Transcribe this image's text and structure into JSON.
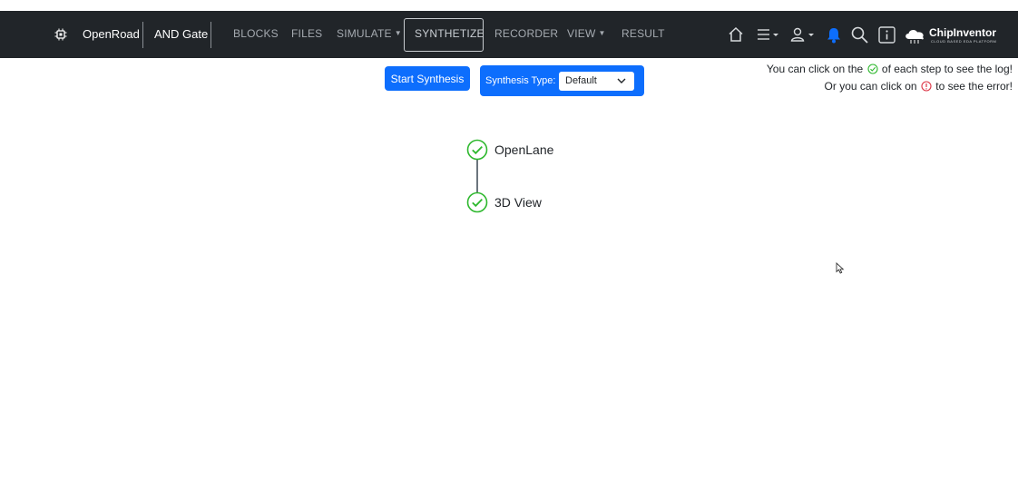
{
  "nav": {
    "brand": "OpenRoad",
    "project": "AND Gate",
    "items": [
      {
        "label": "BLOCKS",
        "caret": false
      },
      {
        "label": "FILES",
        "caret": false
      },
      {
        "label": "SIMULATE",
        "caret": true
      },
      {
        "label": "SYNTHETIZE",
        "caret": false,
        "active": true
      },
      {
        "label": "RECORDER",
        "caret": false
      },
      {
        "label": "VIEW",
        "caret": true
      },
      {
        "label": "RESULT",
        "caret": false
      }
    ],
    "logo_name": "ChipInventor",
    "logo_tagline": "CLOUD BASED EDA PLATFORM",
    "icons": [
      "home-icon",
      "menu-icon",
      "user-icon",
      "bell-icon",
      "search-icon",
      "info-icon"
    ],
    "bar_color": "#212529",
    "bell_color": "#0d6efd"
  },
  "toolbar": {
    "start_label": "Start Synthesis",
    "synthesis_type_label": "Synthesis Type:",
    "synthesis_type_value": "Default",
    "accent_color": "#0d6efd"
  },
  "hints": {
    "line1_before": "You can click on the",
    "line1_after": "of each step to see the log!",
    "line2_before": "Or you can click on",
    "line2_after": "to see the error!"
  },
  "steps": [
    {
      "label": "OpenLane",
      "status": "success"
    },
    {
      "label": "3D View",
      "status": "success"
    }
  ],
  "colors": {
    "success": "#2eb82e",
    "error": "#dc3545"
  }
}
